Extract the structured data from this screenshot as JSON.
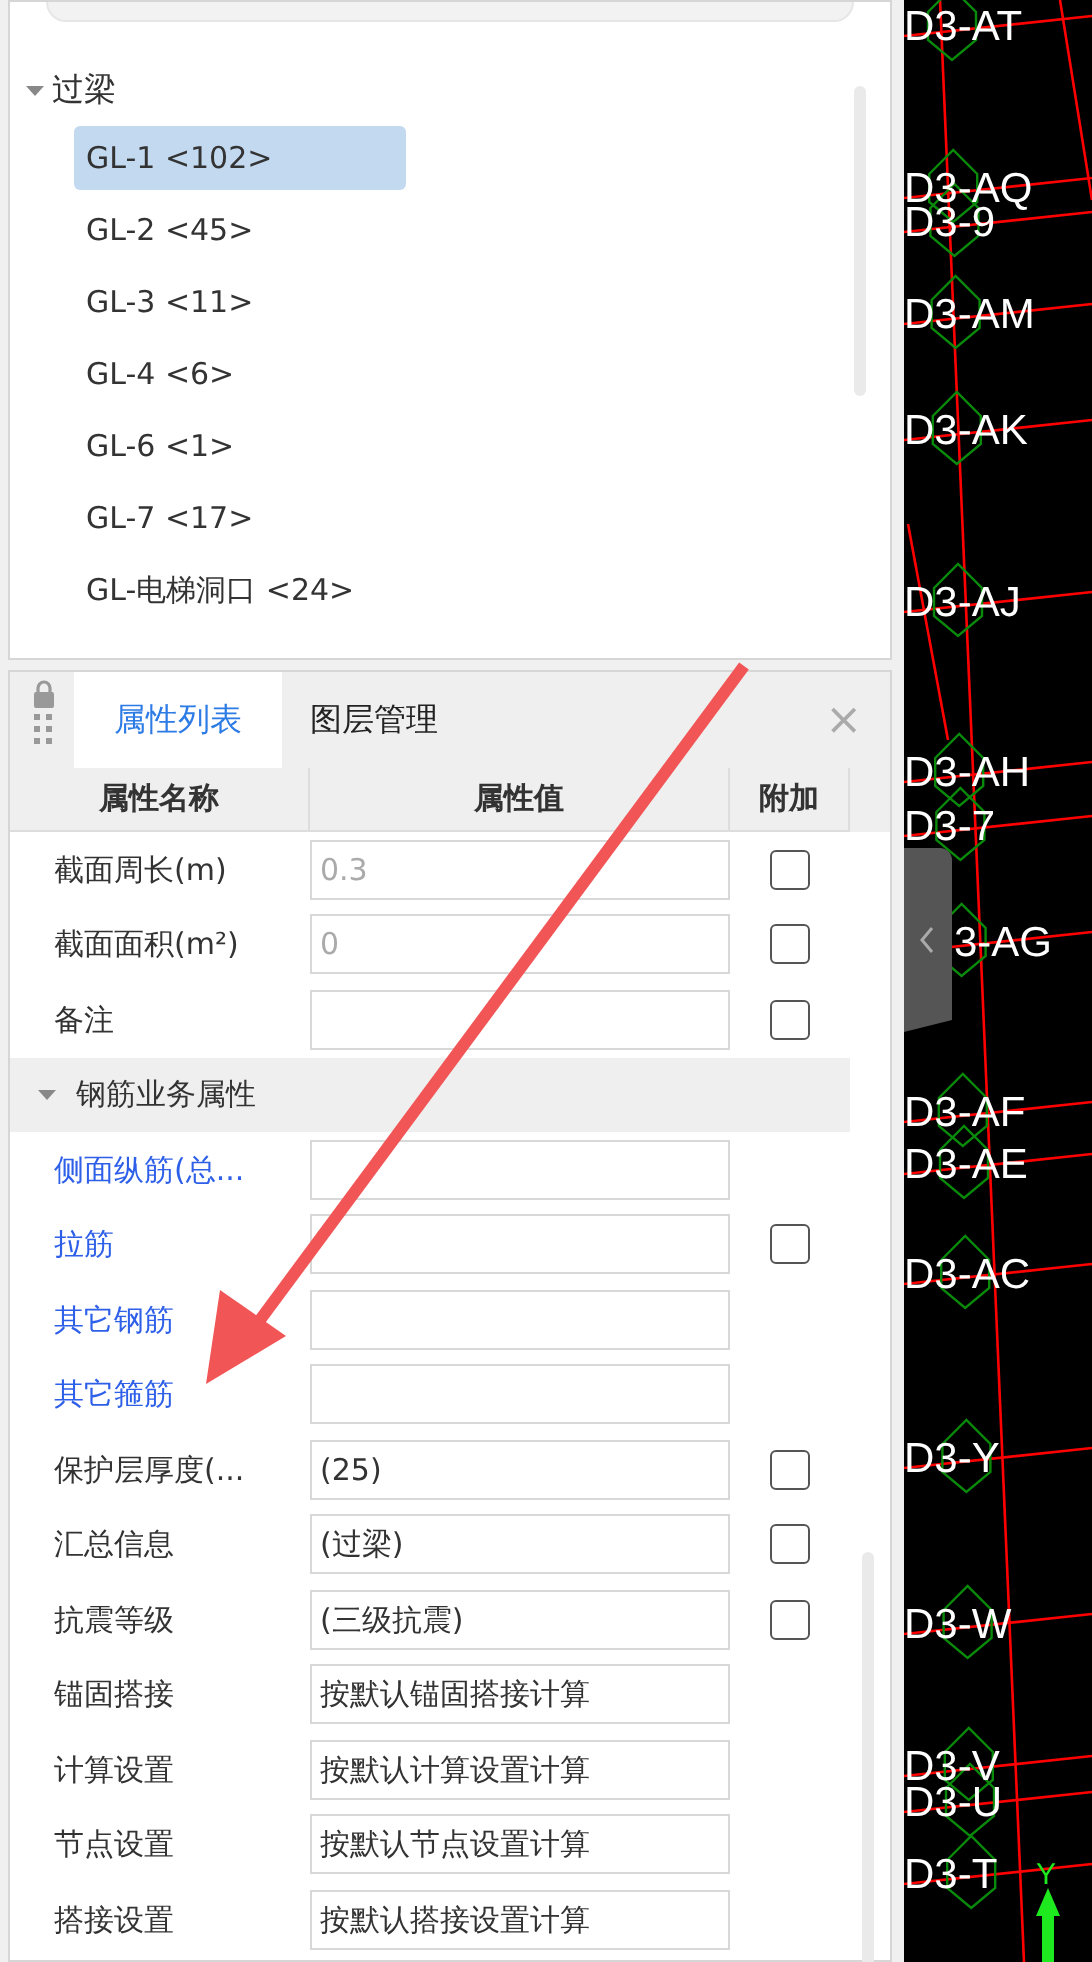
{
  "tree": {
    "group": {
      "label": "过梁",
      "expanded": true
    },
    "items": [
      {
        "label": "GL-1 <102>",
        "selected": true
      },
      {
        "label": "GL-2 <45>",
        "selected": false
      },
      {
        "label": "GL-3 <11>",
        "selected": false
      },
      {
        "label": "GL-4 <6>",
        "selected": false
      },
      {
        "label": "GL-6 <1>",
        "selected": false
      },
      {
        "label": "GL-7 <17>",
        "selected": false
      },
      {
        "label": "GL-电梯洞口 <24>",
        "selected": false
      }
    ]
  },
  "panel": {
    "tabs": [
      {
        "label": "属性列表",
        "selected": true
      },
      {
        "label": "图层管理",
        "selected": false
      }
    ],
    "close": "×",
    "columns": [
      "属性名称",
      "属性值",
      "附加"
    ],
    "rows": [
      {
        "kind": "check",
        "name": "截面周长(m)",
        "value": "0.3",
        "readonly": true,
        "private": false,
        "checked": false
      },
      {
        "kind": "check",
        "name": "截面面积(m²)",
        "value": "0",
        "readonly": true,
        "private": false,
        "checked": false
      },
      {
        "kind": "check",
        "name": "备注",
        "value": "",
        "private": false,
        "checked": false
      },
      {
        "kind": "group",
        "name": "钢筋业务属性",
        "expanded": true
      },
      {
        "kind": "plain",
        "name": "侧面纵筋(总...",
        "value": "",
        "private": true
      },
      {
        "kind": "check",
        "name": "拉筋",
        "value": "",
        "private": true,
        "checked": false
      },
      {
        "kind": "plain",
        "name": "其它钢筋",
        "value": "",
        "private": true
      },
      {
        "kind": "plain",
        "name": "其它箍筋",
        "value": "",
        "private": true
      },
      {
        "kind": "check",
        "name": "保护层厚度(...",
        "value": "(25)",
        "readonly": false,
        "private": false,
        "checked": false
      },
      {
        "kind": "check",
        "name": "汇总信息",
        "value": "(过梁)",
        "readonly": false,
        "private": false,
        "checked": false
      },
      {
        "kind": "check",
        "name": "抗震等级",
        "value": "(三级抗震)",
        "readonly": false,
        "private": false,
        "checked": false
      },
      {
        "kind": "plain",
        "name": "锚固搭接",
        "value": "按默认锚固搭接计算",
        "readonly": false,
        "private": false
      },
      {
        "kind": "plain",
        "name": "计算设置",
        "value": "按默认计算设置计算",
        "readonly": false,
        "private": false
      },
      {
        "kind": "plain",
        "name": "节点设置",
        "value": "按默认节点设置计算",
        "readonly": false,
        "private": false
      },
      {
        "kind": "plain",
        "name": "搭接设置",
        "value": "按默认搭接设置计算",
        "readonly": false,
        "private": false
      }
    ]
  },
  "canvas": {
    "labels": [
      {
        "text": "D3-AT"
      },
      {
        "text": "D3-AQ"
      },
      {
        "text": "D3-9"
      },
      {
        "text": "D3-AM"
      },
      {
        "text": "D3-AK"
      },
      {
        "text": "D3-AJ"
      },
      {
        "text": "D3-AH"
      },
      {
        "text": "D3-7"
      },
      {
        "text": "3-AG"
      },
      {
        "text": "D3-AF"
      },
      {
        "text": "D3-AE"
      },
      {
        "text": "D3-AC"
      },
      {
        "text": "D3-Y"
      },
      {
        "text": "D3-W"
      },
      {
        "text": "D3-V"
      },
      {
        "text": "D3-U"
      },
      {
        "text": "D3-T"
      }
    ],
    "axis_label": "Y"
  }
}
